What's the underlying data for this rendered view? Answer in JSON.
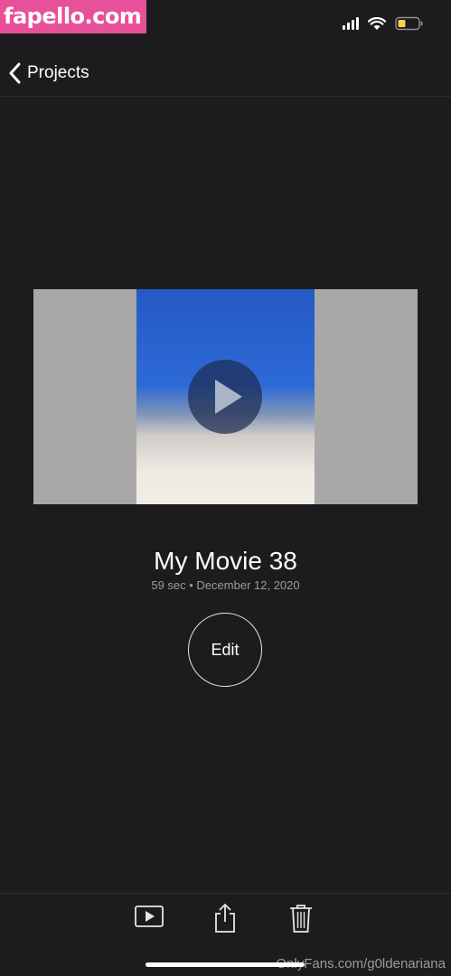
{
  "watermark": {
    "top_text": "fapello.com",
    "bottom_text": "OnlyFans.com/g0ldenariana"
  },
  "status_bar": {
    "signal_icon": "cellular-signal-icon",
    "wifi_icon": "wifi-icon",
    "battery_icon": "battery-icon",
    "battery_color": "#f7d248"
  },
  "nav": {
    "back_label": "Projects"
  },
  "project": {
    "title": "My Movie 38",
    "meta": "59 sec • December 12, 2020",
    "edit_label": "Edit"
  },
  "toolbar": {
    "items": [
      "play-icon",
      "share-icon",
      "trash-icon"
    ]
  },
  "colors": {
    "background": "#1c1c1e",
    "watermark": "#e8509a",
    "letterbox": "#a8a8a8"
  }
}
